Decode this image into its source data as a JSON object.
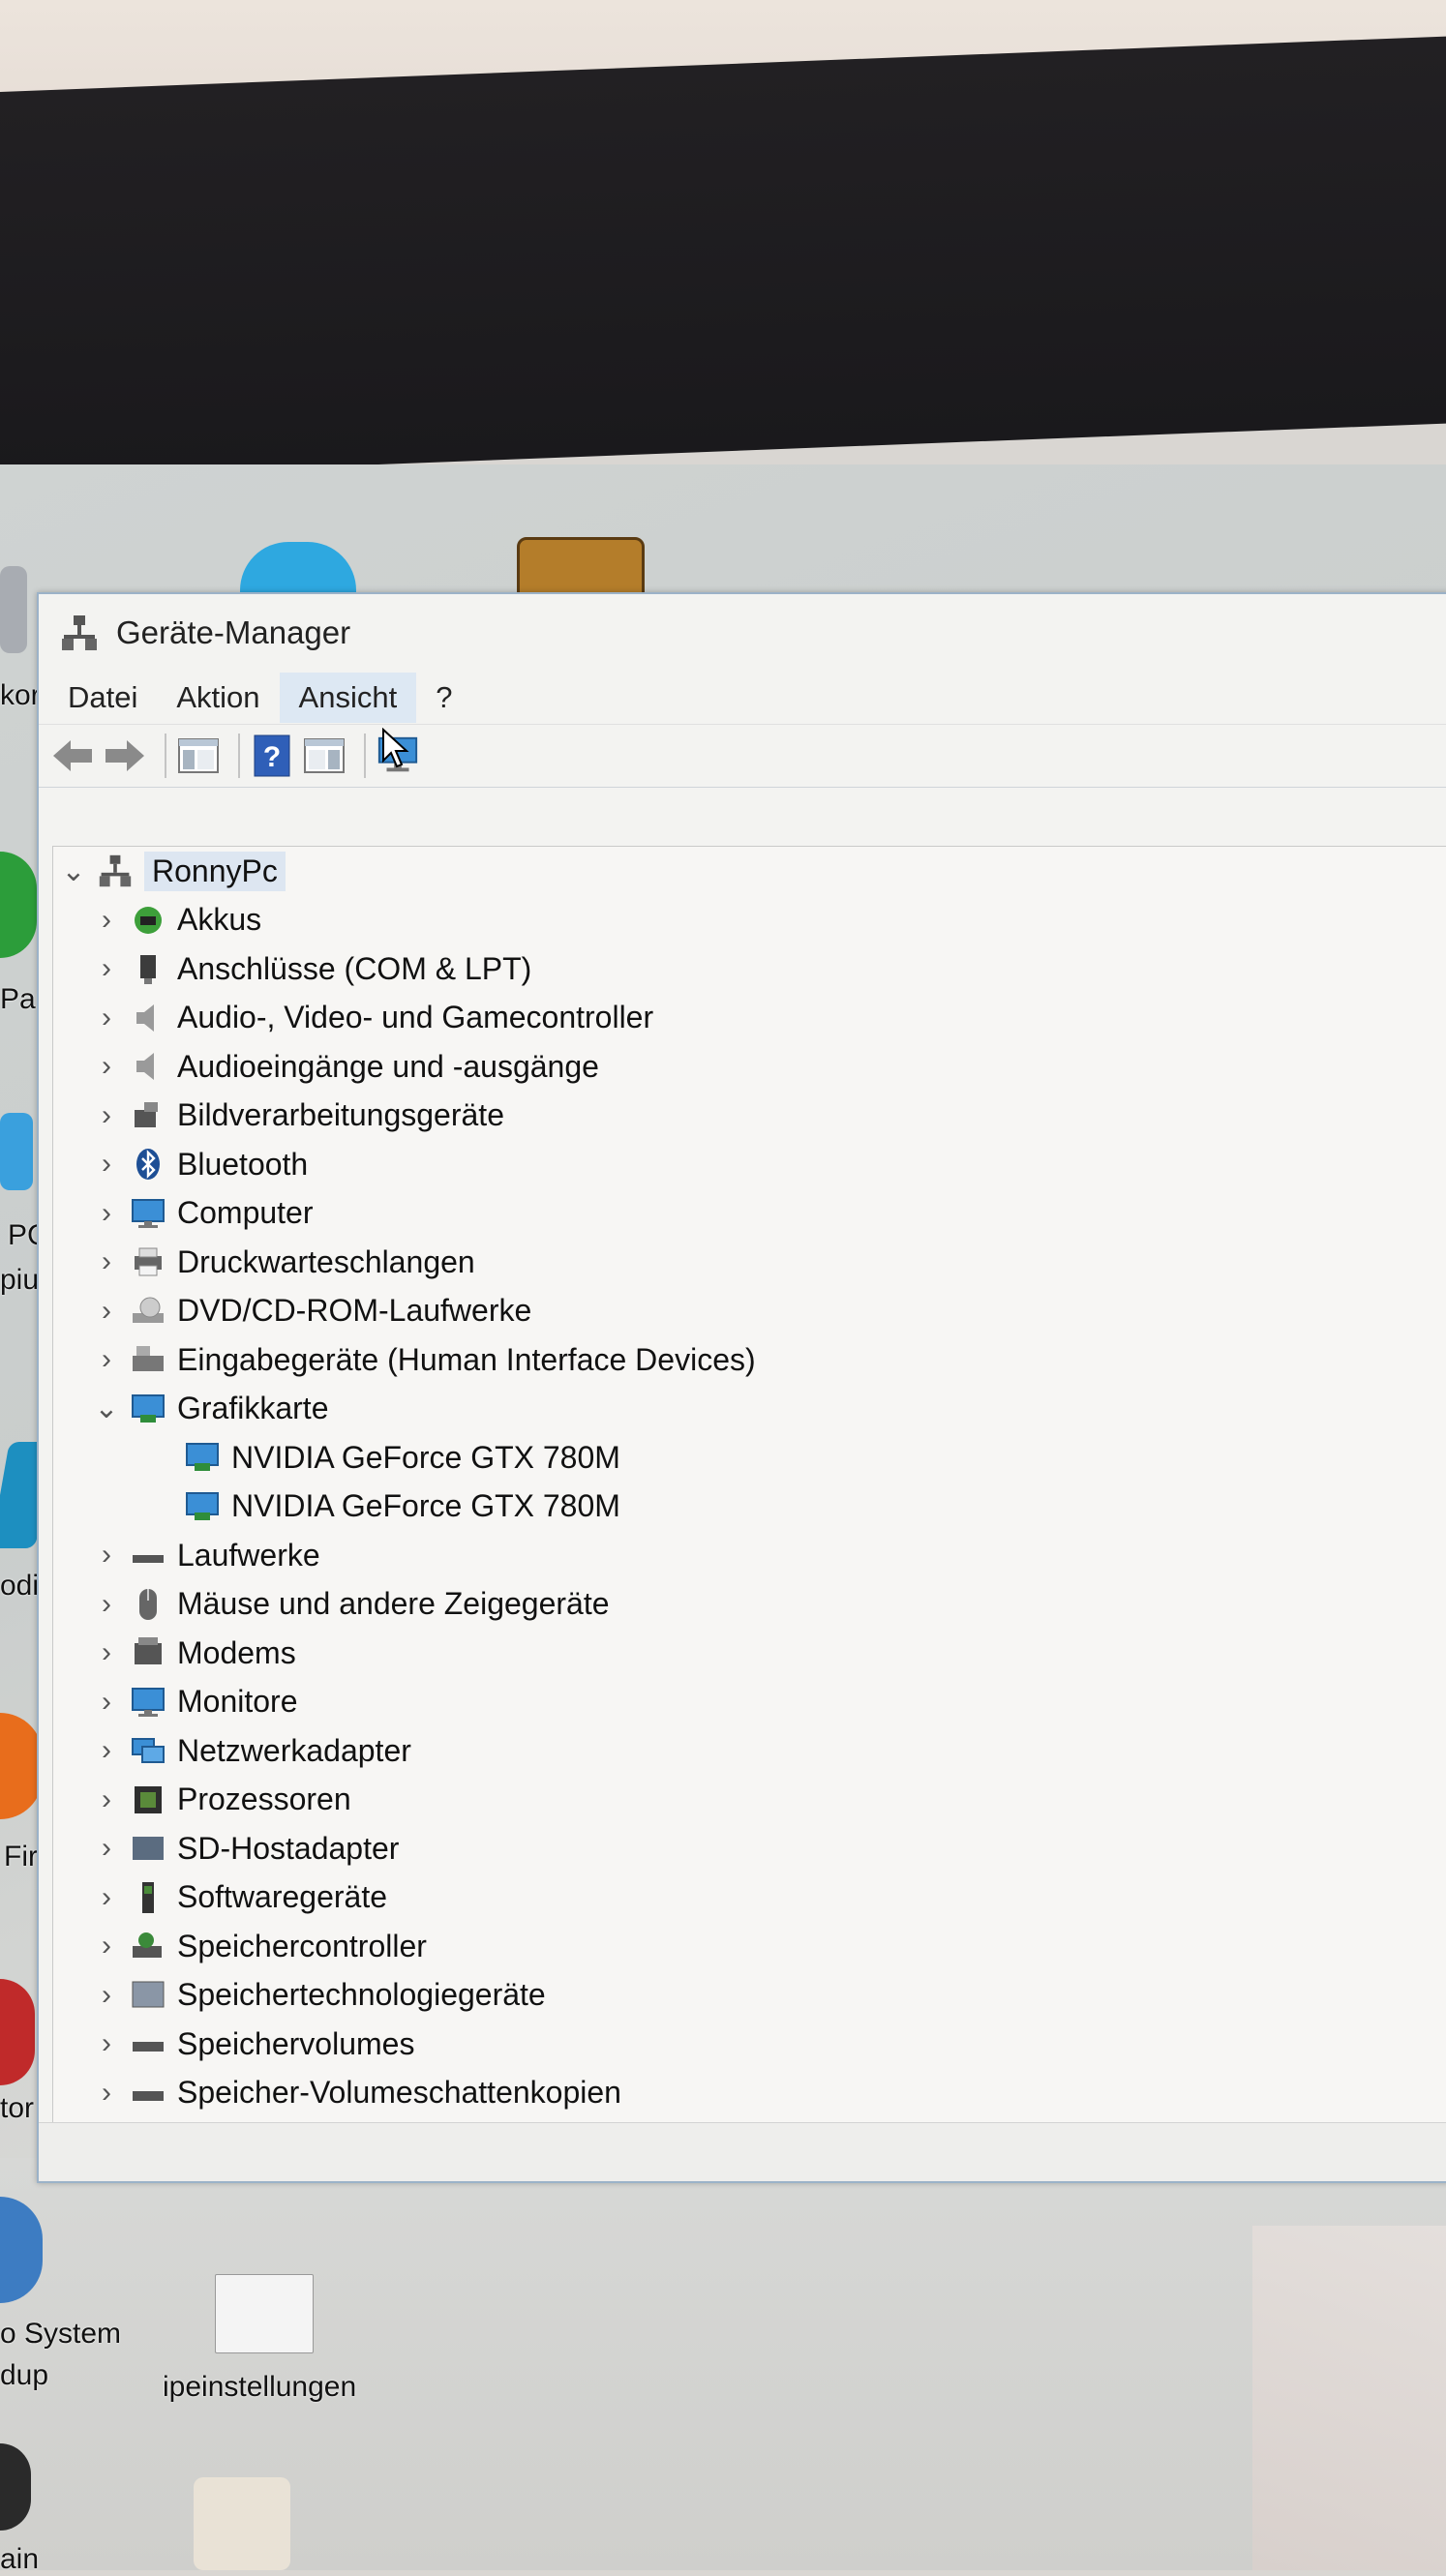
{
  "window": {
    "title": "Geräte-Manager"
  },
  "menu": {
    "items": [
      "Datei",
      "Aktion",
      "Ansicht",
      "?"
    ],
    "hovered": "Ansicht"
  },
  "desktop": {
    "labels": [
      "kor",
      "Par",
      "PC",
      "piu",
      "odi",
      "Fire",
      "tor",
      "o System",
      "dup",
      "ipeinstellungen",
      "ain"
    ]
  },
  "tree": {
    "root": "RonnyPc",
    "items": [
      {
        "label": "Akkus",
        "icon": "battery-icon",
        "expanded": false
      },
      {
        "label": "Anschlüsse (COM & LPT)",
        "icon": "port-icon",
        "expanded": false
      },
      {
        "label": "Audio-, Video- und Gamecontroller",
        "icon": "speaker-icon",
        "expanded": false
      },
      {
        "label": "Audioeingänge und -ausgänge",
        "icon": "speaker-icon",
        "expanded": false
      },
      {
        "label": "Bildverarbeitungsgeräte",
        "icon": "camera-icon",
        "expanded": false
      },
      {
        "label": "Bluetooth",
        "icon": "bluetooth-icon",
        "expanded": false
      },
      {
        "label": "Computer",
        "icon": "monitor-icon",
        "expanded": false
      },
      {
        "label": "Druckwarteschlangen",
        "icon": "printer-icon",
        "expanded": false
      },
      {
        "label": "DVD/CD-ROM-Laufwerke",
        "icon": "disc-drive-icon",
        "expanded": false
      },
      {
        "label": "Eingabegeräte (Human Interface Devices)",
        "icon": "keyboard-icon",
        "expanded": false
      },
      {
        "label": "Grafikkarte",
        "icon": "display-adapter-icon",
        "expanded": true,
        "children": [
          "NVIDIA GeForce GTX 780M",
          "NVIDIA GeForce GTX 780M"
        ]
      },
      {
        "label": "Laufwerke",
        "icon": "drive-icon",
        "expanded": false
      },
      {
        "label": "Mäuse und andere Zeigegeräte",
        "icon": "mouse-icon",
        "expanded": false
      },
      {
        "label": "Modems",
        "icon": "modem-icon",
        "expanded": false
      },
      {
        "label": "Monitore",
        "icon": "monitor-icon",
        "expanded": false
      },
      {
        "label": "Netzwerkadapter",
        "icon": "network-icon",
        "expanded": false
      },
      {
        "label": "Prozessoren",
        "icon": "processor-icon",
        "expanded": false
      },
      {
        "label": "SD-Hostadapter",
        "icon": "sd-icon",
        "expanded": false
      },
      {
        "label": "Softwaregeräte",
        "icon": "software-device-icon",
        "expanded": false
      },
      {
        "label": "Speichercontroller",
        "icon": "storage-controller-icon",
        "expanded": false
      },
      {
        "label": "Speichertechnologiegeräte",
        "icon": "memory-tech-icon",
        "expanded": false
      },
      {
        "label": "Speichervolumes",
        "icon": "volume-icon",
        "expanded": false
      },
      {
        "label": "Speicher-Volumeschattenkopien",
        "icon": "volume-icon",
        "expanded": false
      }
    ]
  }
}
